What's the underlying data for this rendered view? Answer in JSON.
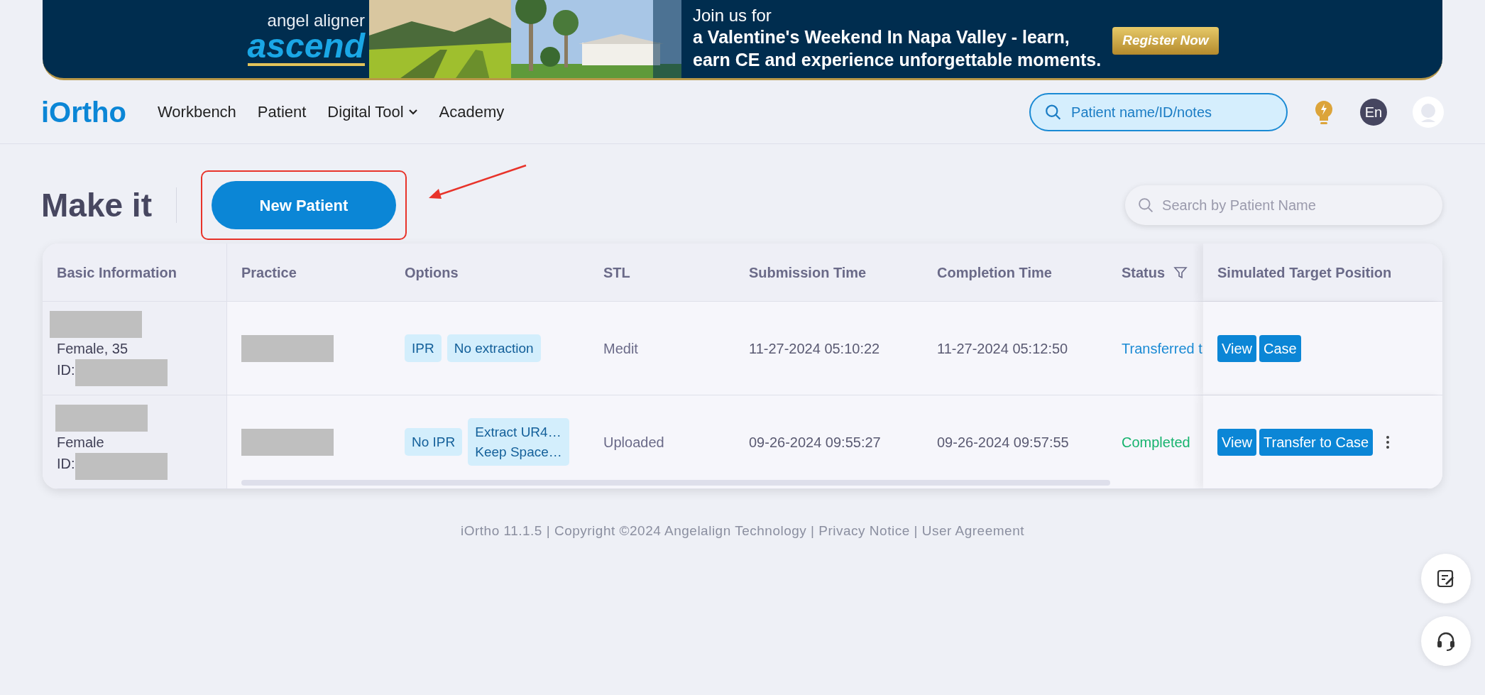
{
  "banner": {
    "brand_top": "angel aligner",
    "brand": "ascend",
    "kicker": "Join us for",
    "headline_lines": [
      "a Valentine's Weekend In Napa Valley - learn,",
      "earn CE and experience unforgettable moments."
    ],
    "cta": "Register Now"
  },
  "navbar": {
    "logo": "iOrtho",
    "items": [
      {
        "label": "Workbench",
        "dropdown": false
      },
      {
        "label": "Patient",
        "dropdown": false
      },
      {
        "label": "Digital Tool",
        "dropdown": true
      },
      {
        "label": "Academy",
        "dropdown": false
      }
    ],
    "search": {
      "placeholder": "Patient name/ID/notes"
    },
    "language": "En"
  },
  "page": {
    "title": "Make it",
    "new_button": "New Patient",
    "search": {
      "placeholder": "Search by Patient Name"
    }
  },
  "annotations": {
    "highlight": true,
    "arrow": true
  },
  "table": {
    "columns": [
      {
        "label": "Basic Information",
        "filter": false
      },
      {
        "label": "Practice",
        "filter": false
      },
      {
        "label": "Options",
        "filter": false
      },
      {
        "label": "STL",
        "filter": false
      },
      {
        "label": "Submission Time",
        "filter": false
      },
      {
        "label": "Completion Time",
        "filter": false
      },
      {
        "label": "Status",
        "filter": true
      },
      {
        "label": "Simulated Target Position",
        "filter": false
      }
    ],
    "rows": [
      {
        "basic": "Female, 35",
        "id_label": "ID:",
        "options": [
          {
            "lines": [
              "IPR"
            ]
          },
          {
            "lines": [
              "No extraction"
            ]
          }
        ],
        "stl": "Medit",
        "submission": "11-27-2024 05:10:22",
        "completion": "11-27-2024 05:12:50",
        "status": {
          "text": "Transferred t",
          "kind": "transferred"
        },
        "actions": [
          "View",
          "Case"
        ],
        "more": false
      },
      {
        "basic": "Female",
        "id_label": "ID:",
        "options": [
          {
            "lines": [
              "No IPR"
            ]
          },
          {
            "lines": [
              "Extract UR4…",
              "Keep Space…"
            ]
          }
        ],
        "stl": "Uploaded",
        "submission": "09-26-2024 09:55:27",
        "completion": "09-26-2024 09:57:55",
        "status": {
          "text": "Completed",
          "kind": "completed"
        },
        "actions": [
          "View",
          "Transfer to Case"
        ],
        "more": true
      }
    ]
  },
  "footer": "iOrtho 11.1.5 | Copyright ©2024 Angelalign Technology | Privacy Notice | User Agreement"
}
